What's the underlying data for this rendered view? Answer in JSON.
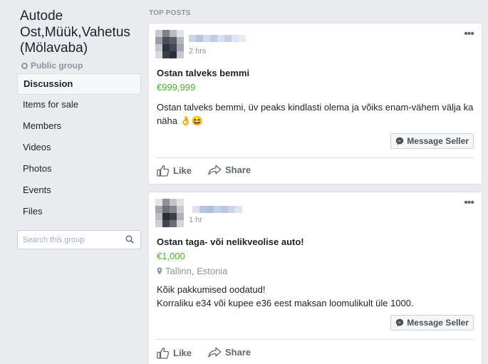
{
  "group": {
    "title": "Autode Ost,Müük,Vahetus (Mölavaba)",
    "type_label": "Public group"
  },
  "nav": {
    "items": [
      {
        "label": "Discussion",
        "active": true
      },
      {
        "label": "Items for sale"
      },
      {
        "label": "Members"
      },
      {
        "label": "Videos"
      },
      {
        "label": "Photos"
      },
      {
        "label": "Events"
      },
      {
        "label": "Files"
      }
    ]
  },
  "search": {
    "placeholder": "Search this group"
  },
  "section": {
    "label": "TOP POSTS"
  },
  "posts": [
    {
      "timestamp": "2 hrs",
      "title": "Ostan talveks bemmi",
      "price": "€999,999",
      "body": "Ostan talveks bemmi, üv peaks kindlasti olema ja võiks enam-vähem välja ka näha 👌😆",
      "message_label": "Message Seller",
      "like_label": "Like",
      "share_label": "Share"
    },
    {
      "timestamp": "1 hr",
      "title": "Ostan taga- või nelikveolise auto!",
      "price": "€1,000",
      "location": "Tallinn, Estonia",
      "body_lines": [
        "Kõik pakkumised oodatud!",
        "Korraliku e34 või kupee e36 eest maksan loomulikult üle 1000."
      ],
      "message_label": "Message Seller",
      "like_label": "Like",
      "share_label": "Share"
    }
  ],
  "colors": {
    "price": "#42b72a",
    "background": "#e9ebee",
    "muted": "#90949c"
  }
}
